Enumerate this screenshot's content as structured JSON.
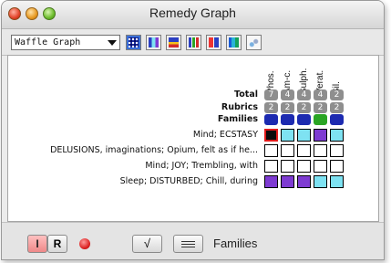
{
  "window": {
    "title": "Remedy Graph"
  },
  "toolbar": {
    "graph_type_value": "Waffle Graph",
    "icons": [
      "waffle-graph-icon",
      "grid-graph-icon",
      "chart-graph-icon",
      "bar-graph-icon",
      "column-graph-icon",
      "groups-graph-icon",
      "sparse-graph-icon"
    ]
  },
  "remedies": [
    "Phos.",
    "Am-c.",
    "Sulph.",
    "Verat.",
    "Sil."
  ],
  "totals_label": "Total",
  "totals": [
    "7",
    "4",
    "4",
    "4",
    "2"
  ],
  "rubrics_count_label": "Rubrics",
  "rubrics_counts": [
    "2",
    "2",
    "2",
    "2",
    "2"
  ],
  "families_label": "Families",
  "families_colors": [
    "#1c2ab0",
    "#1c2ab0",
    "#1c2ab0",
    "#2aa524",
    "#1c2ab0"
  ],
  "rubrics": [
    {
      "label": "Mind; ECSTASY",
      "cells": [
        "#0b0b0b",
        "#7ee2f2",
        "#7ee2f2",
        "#7e3bd2",
        "#7ee2f2"
      ],
      "highlight_first": true
    },
    {
      "label": "DELUSIONS, imaginations; Opium, felt as if he...",
      "cells": [
        "#ffffff",
        "#ffffff",
        "#ffffff",
        "#ffffff",
        "#ffffff"
      ]
    },
    {
      "label": "Mind; JOY; Trembling, with",
      "cells": [
        "#ffffff",
        "#ffffff",
        "#ffffff",
        "#ffffff",
        "#ffffff"
      ]
    },
    {
      "label": "Sleep; DISTURBED; Chill, during",
      "cells": [
        "#7e3bd2",
        "#7e3bd2",
        "#7e3bd2",
        "#7ee2f2",
        "#7ee2f2"
      ]
    }
  ],
  "bottom": {
    "i_label": "I",
    "r_label": "R",
    "families_text": "Families"
  }
}
